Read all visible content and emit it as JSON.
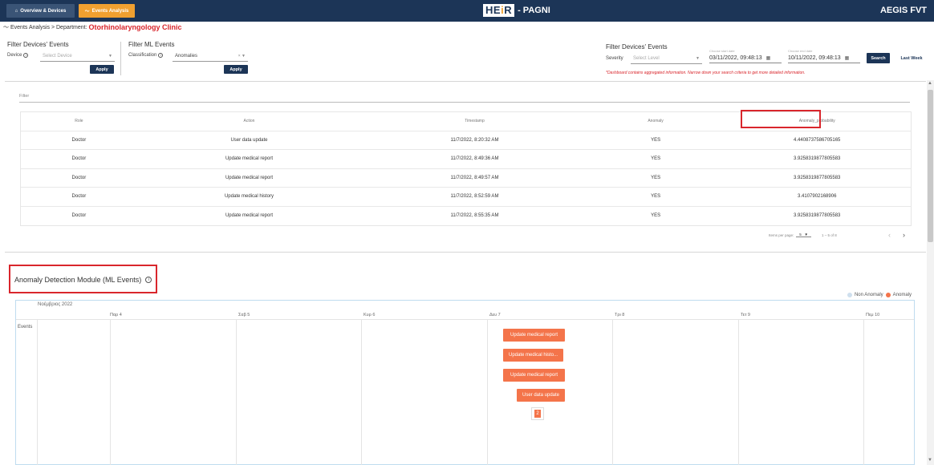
{
  "topbar": {
    "overview_label": "Overview & Devices",
    "events_label": "Events Analysis",
    "brand_logo_a": "HE",
    "brand_logo_b": "i",
    "brand_logo_c": "R",
    "brand_sub": "- PAGNI",
    "org": "AEGIS FVT",
    "home_icon": "home-icon",
    "activity_icon": "activity-icon"
  },
  "breadcrumb": {
    "path": "Events Analysis > Department:",
    "department": "Otorhinolaryngology Clinic"
  },
  "filters": {
    "devices": {
      "title": "Filter Devices' Events",
      "label": "Device",
      "placeholder": "Select Device",
      "apply": "Apply"
    },
    "ml": {
      "title": "Filter ML Events",
      "label": "Classification",
      "value": "Anomalies",
      "apply": "Apply"
    },
    "severity": {
      "title": "Filter Devices' Events",
      "label": "Severity",
      "placeholder": "Select Level"
    },
    "start_caption": "Choose start date",
    "start_date": "03/11/2022, 09:48:13",
    "end_caption": "Choose end date",
    "end_date": "10/11/2022, 09:48:13",
    "search": "Search",
    "last_week": "Last Week",
    "disclaimer": "*Dashboard contains aggregated information. Narrow down your search criteria to get more detailed information."
  },
  "table": {
    "filter_label": "Filter",
    "headers": [
      "Role",
      "Action",
      "Timestamp",
      "Anomaly",
      "Anomaly_probability"
    ],
    "rows": [
      [
        "Doctor",
        "User data update",
        "11/7/2022, 8:20:32 AM",
        "YES",
        "4.4408737586705165"
      ],
      [
        "Doctor",
        "Update medical report",
        "11/7/2022, 8:49:36 AM",
        "YES",
        "3.9258319877805583"
      ],
      [
        "Doctor",
        "Update medical report",
        "11/7/2022, 8:49:57 AM",
        "YES",
        "3.9258319877805583"
      ],
      [
        "Doctor",
        "Update medical history",
        "11/7/2022, 8:52:59 AM",
        "YES",
        "3.4107902168906"
      ],
      [
        "Doctor",
        "Update medical report",
        "11/7/2022, 8:55:35 AM",
        "YES",
        "3.9258319877805583"
      ]
    ],
    "rows_per_page_label": "Items per page:",
    "rows_per_page": "5",
    "range": "1 – 5 of 8"
  },
  "module": {
    "title": "Anomaly Detection Module (ML Events)",
    "legend_non": "Non Anomaly",
    "legend_anomaly": "Anomaly",
    "month": "Νοέμβριος 2022",
    "days": [
      "Παρ 4",
      "Σαβ 5",
      "Κυρ 6",
      "Δευ 7",
      "Τρι 8",
      "Τετ 9",
      "Πεμ 10"
    ],
    "row_header": "Events",
    "events": [
      "Update medical report",
      "Update medical histo...",
      "Update medical report",
      "User data update"
    ],
    "more_count": "2"
  },
  "colors": {
    "navy": "#1c3557",
    "orange": "#f0a030",
    "anomaly": "#f4744a",
    "highlight_red": "#d9262c"
  }
}
